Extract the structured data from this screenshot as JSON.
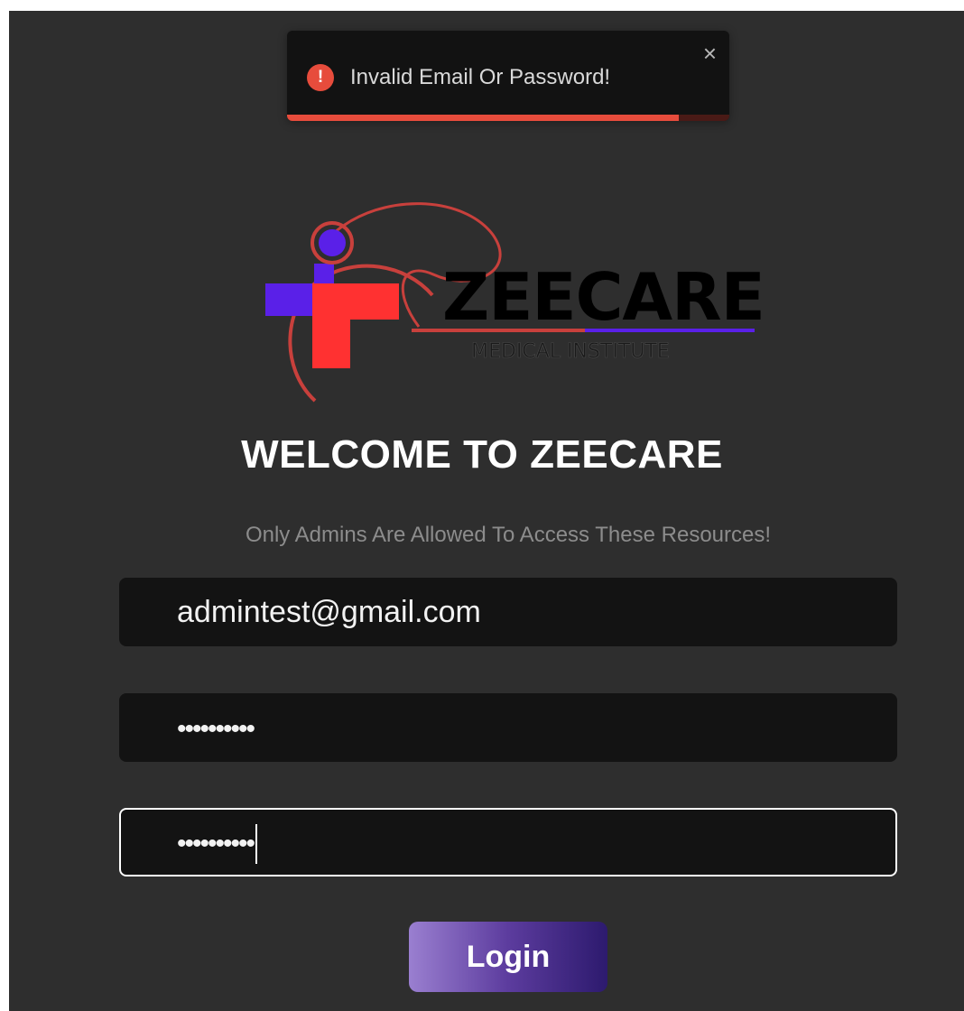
{
  "toast": {
    "message": "Invalid Email Or Password!",
    "icon": "error-icon",
    "close_label": "×",
    "progress": 0.8857,
    "color": "#e74c3c"
  },
  "logo": {
    "brand_text": "ZEECARE",
    "tagline": "MEDICAL INSTITUTE",
    "colors": {
      "red": "#ff3131",
      "purple": "#5a20e8"
    }
  },
  "page": {
    "title": "WELCOME TO ZEECARE",
    "subtitle": "Only Admins Are Allowed To Access These Resources!"
  },
  "form": {
    "email_value": "admintest@gmail.com",
    "password_value": "••••••••••",
    "confirm_password_value": "••••••••••",
    "login_label": "Login"
  }
}
